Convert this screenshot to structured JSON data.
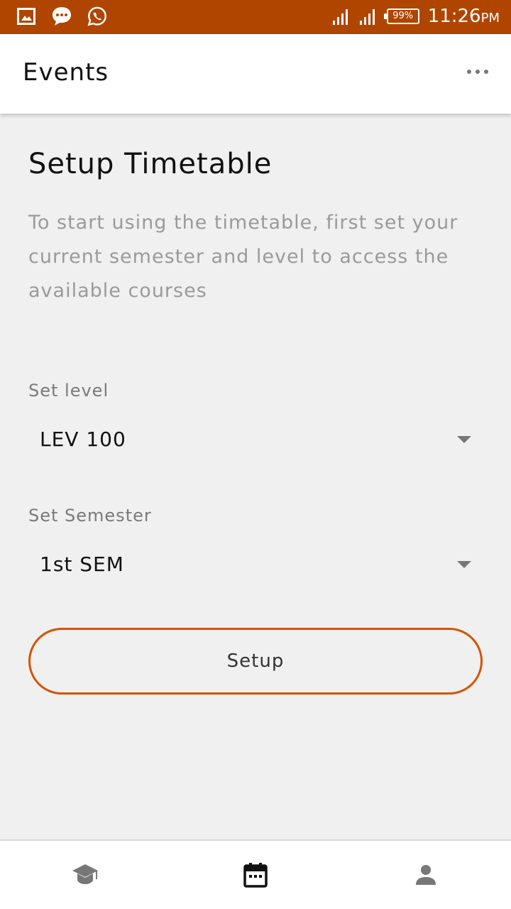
{
  "status_bar": {
    "left_icons": [
      "gallery-icon",
      "message-icon",
      "whatsapp-icon"
    ],
    "battery": "99%",
    "time": "11:26",
    "time_suffix": "PM"
  },
  "app_bar": {
    "title": "Events",
    "overflow_icon": "more-horizontal-icon"
  },
  "main": {
    "heading": "Setup Timetable",
    "description": "To start using the timetable, first set your current semester and level to access the available courses",
    "level_field": {
      "label": "Set  level",
      "value": "LEV 100"
    },
    "semester_field": {
      "label": "Set Semester",
      "value": "1st SEM"
    },
    "setup_button": "Setup"
  },
  "bottom_nav": {
    "items": [
      "graduation-cap-icon",
      "calendar-icon",
      "person-icon"
    ],
    "active_index": 1
  },
  "colors": {
    "status_bar": "#b04500",
    "accent": "#d35400",
    "background": "#f0f0f0"
  }
}
